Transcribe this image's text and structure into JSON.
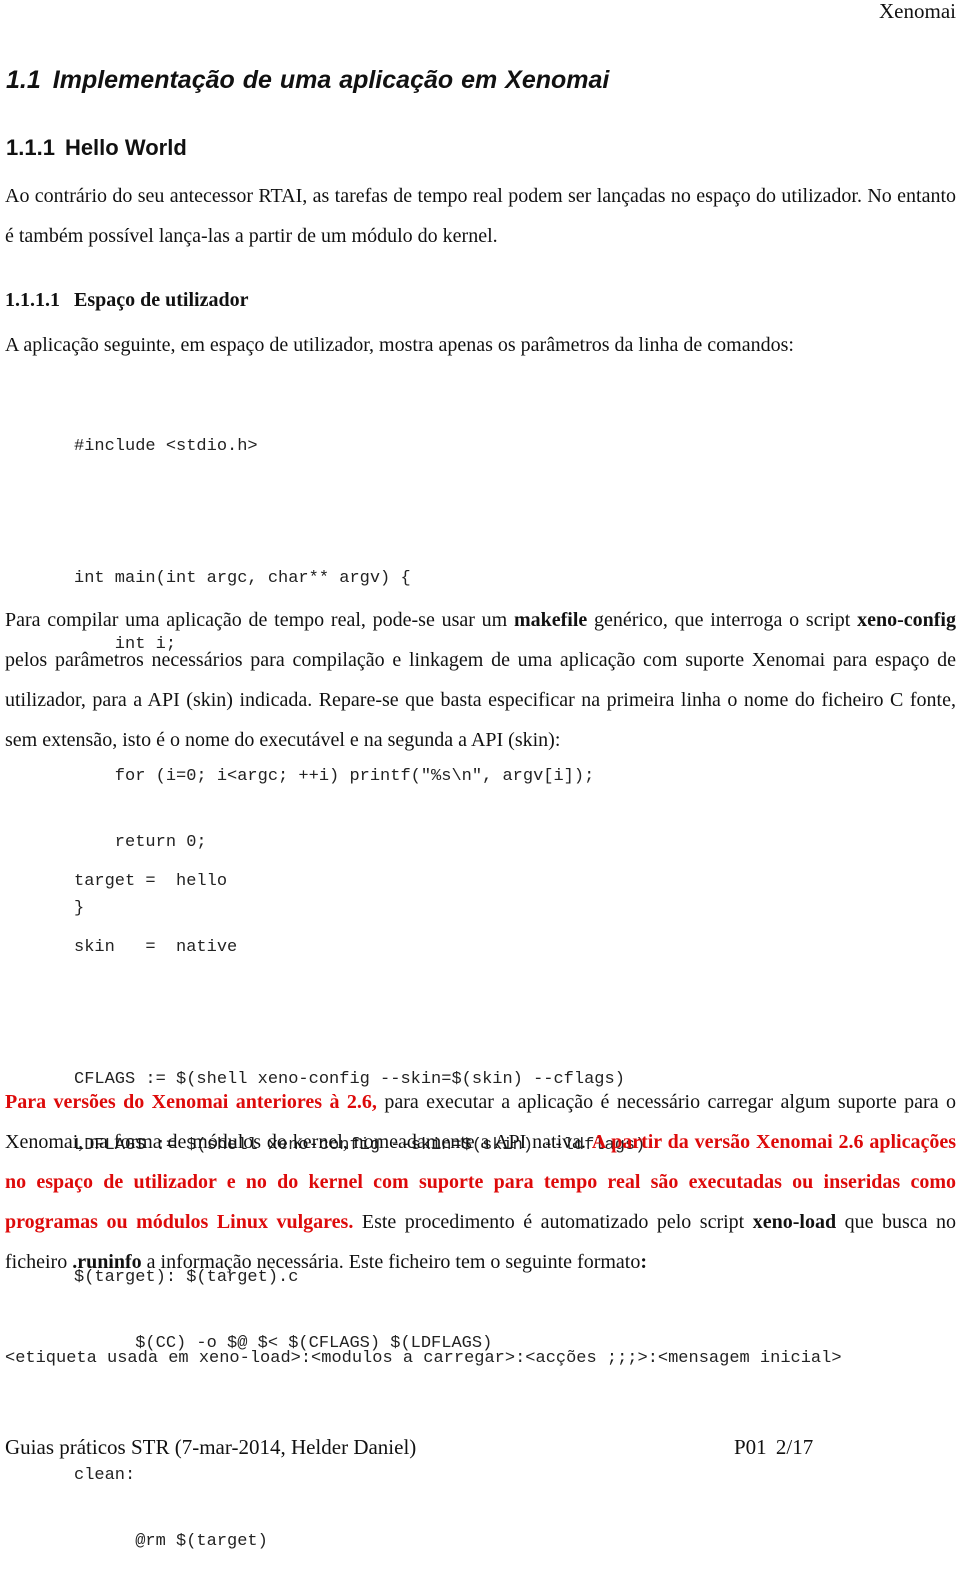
{
  "header": {
    "running_title": "Xenomai"
  },
  "section": {
    "number": "1.1",
    "title": "Implementação de uma aplicação em Xenomai"
  },
  "subsection": {
    "number": "1.1.1",
    "title": "Hello World"
  },
  "intro_paragraph": "Ao contrário do seu antecessor RTAI, as tarefas de tempo real podem ser lançadas no espaço do utilizador. No entanto é também possível lança-las a partir de um módulo do kernel.",
  "subsubsection": {
    "number": "1.1.1.1",
    "title": "Espaço de utilizador"
  },
  "app_intro": "A aplicação seguinte, em espaço de utilizador, mostra apenas os parâmetros da linha de comandos:",
  "code_c": {
    "lines": [
      "#include <stdio.h>",
      "",
      "int main(int argc, char** argv) {",
      "    int i;",
      "",
      "    for (i=0; i<argc; ++i) printf(\"%s\\n\", argv[i]);",
      "    return 0;",
      "}"
    ]
  },
  "compile_paragraph": {
    "t1": "Para compilar uma aplicação de tempo real, pode-se usar um ",
    "b1": "makefile",
    "t2": " genérico, que interroga o script ",
    "b2": "xeno-config",
    "t3": " pelos parâmetros necessários para compilação e linkagem de uma aplicação com suporte Xenomai para espaço de utilizador, para a API (skin) indicada. Repare-se que basta especificar na primeira linha o nome do ficheiro C fonte, sem extensão, isto é o nome do executável e na segunda a API (skin):"
  },
  "code_makefile": {
    "lines": [
      "target =  hello",
      "skin   =  native",
      "",
      "CFLAGS := $(shell xeno-config --skin=$(skin) --cflags)",
      "LDFLAGS := $(shell xeno-config --skin=$(skin) --ldflags)",
      "",
      "$(target): $(target).c",
      "      $(CC) -o $@ $< $(CFLAGS) $(LDFLAGS)",
      "",
      "clean:",
      "      @rm $(target)"
    ]
  },
  "versions_paragraph": {
    "r1": "Para versões do Xenomai anteriores à 2.6,",
    "t1": " para executar a aplicação é necessário carregar algum suporte para o Xenomai, na forma de módulos do kernel, nomeadamente a API nativa. ",
    "r2": "A partir da versão Xenomai 2.6 aplicações no espaço de utilizador e no do kernel com suporte para tempo real são executadas ou inseridas como programas ou módulos Linux vulgares.",
    "t2": " Este procedimento é automatizado pelo script ",
    "b1": "xeno-load",
    "t3": " que busca no ficheiro ",
    "b2": ".runinfo",
    "t4": " a informação necessária. Este ficheiro tem o seguinte formato",
    "b3": ":"
  },
  "runinfo_format": "<etiqueta usada em xeno-load>:<modulos a carregar>:<acções ;;;>:<mensagem inicial>",
  "footer": {
    "left": "Guias práticos STR (7-mar-2014, Helder Daniel)",
    "right": "P01  2/17"
  },
  "colors": {
    "highlight_red": "#dd0a0a",
    "text": "#111111"
  }
}
